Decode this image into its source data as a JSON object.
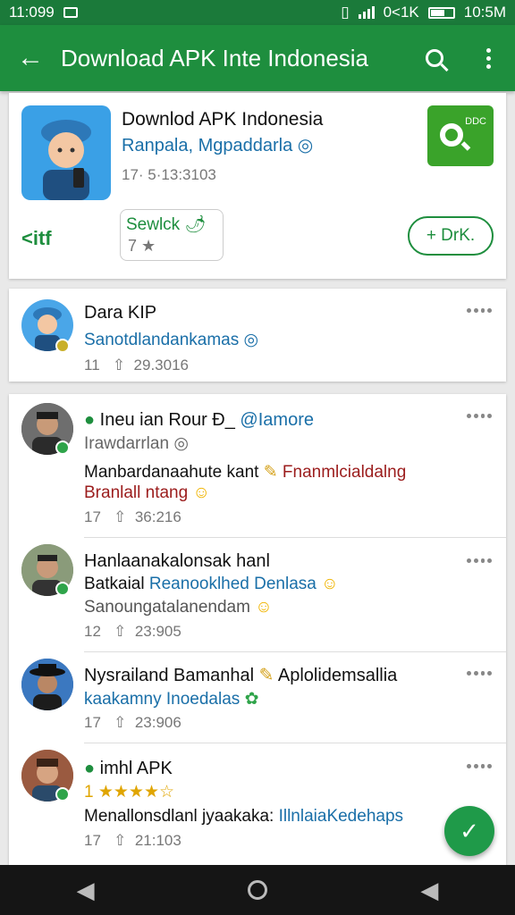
{
  "status_bar": {
    "time_left": "11:099",
    "time_right": "10:5M",
    "carrier": "0<1K"
  },
  "app_bar": {
    "back_icon": "arrow-left-icon",
    "title": "Download APK Inte Indonesia"
  },
  "app_card": {
    "name": "Downlod APK Indonesia",
    "developer": "Ranpala, Mgpaddarla ◎",
    "meta": "17· 5·13:3103",
    "badge_text": "DDC",
    "left_action": "<itf",
    "rating_top": "Sewlck 🌶",
    "rating_bottom": "7 ★",
    "download_label": "+ DrK."
  },
  "dev_card": {
    "name": "Dara KIP",
    "handle": "Sanotdlandankamas ◎",
    "meta_count": "11",
    "meta_value": "29.3016"
  },
  "reviews": [
    {
      "name": "Ineu ian Rour Đ_",
      "handle": "@Iamore",
      "sub": "Irawdarrlan ◎",
      "text1": "Manbardanaahute kant",
      "text1b": "Fnanmlcialdalng",
      "text2": "Branlall ntang",
      "meta_count": "17",
      "meta_value": "36:216"
    },
    {
      "name": "Hanlaanakalonsak hanl",
      "sub": "Batkaial",
      "sub2": "Reanooklhed Denlasa",
      "text1": "Sanoungatalanendam",
      "meta_count": "12",
      "meta_value": "23:905"
    },
    {
      "name": "Nysrailand Bamanhal",
      "name2": "Aplolidemsallia",
      "sub": "kaakamny Inoedalas",
      "meta_count": "17",
      "meta_value": "23:906"
    },
    {
      "name": "imhl APK",
      "stars": "1 ★★★★☆",
      "text1": "Menallonsdlanl jyaakaka:",
      "text1b": "IllnlaiaKedehaps",
      "meta_count": "17",
      "meta_value": "21:103"
    }
  ],
  "colors": {
    "primary": "#1e8e3e",
    "status": "#1b7a3a",
    "link": "#1a6fa8",
    "accent_red": "#9b1c1c"
  }
}
